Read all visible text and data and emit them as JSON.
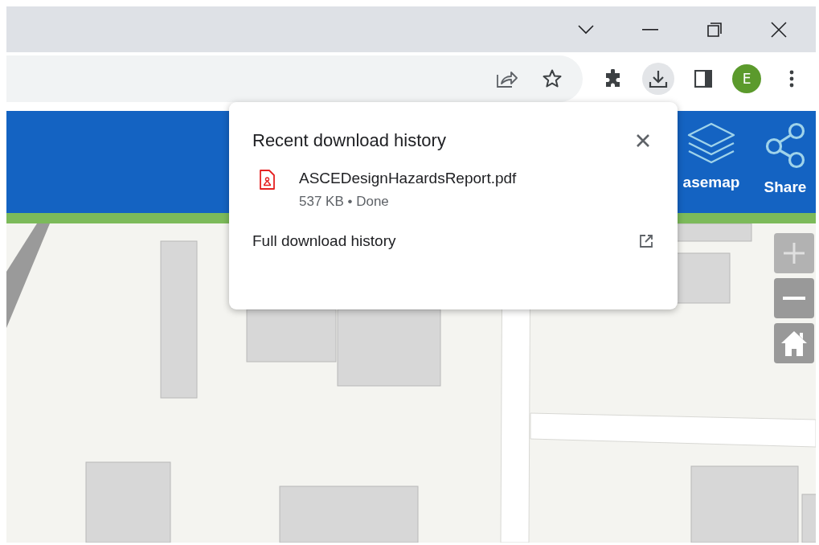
{
  "window": {
    "controls": [
      {
        "kind": "tab-search"
      },
      {
        "kind": "minimize"
      },
      {
        "kind": "restore"
      },
      {
        "kind": "close"
      }
    ]
  },
  "toolbar": {
    "address_actions": [
      {
        "kind": "share"
      },
      {
        "kind": "bookmark"
      }
    ],
    "actions": [
      {
        "kind": "extensions",
        "active": false
      },
      {
        "kind": "downloads",
        "active": true
      },
      {
        "kind": "side-panel",
        "active": false
      }
    ],
    "profile": {
      "initial": "E"
    }
  },
  "app_header": {
    "items": [
      {
        "kind": "layers",
        "label": "asemap"
      },
      {
        "kind": "share",
        "label": "Share"
      }
    ]
  },
  "map": {
    "kind": "picture",
    "controls": [
      {
        "kind": "zoom-in",
        "disabled": true
      },
      {
        "kind": "zoom-out",
        "disabled": false
      },
      {
        "kind": "home",
        "disabled": false
      }
    ]
  },
  "download_popup": {
    "title": "Recent download history",
    "items": [
      {
        "kind": "pdf",
        "filename": "ASCEDesignHazardsReport.pdf",
        "status": "537 KB • Done"
      }
    ],
    "footer_link": "Full download history"
  }
}
